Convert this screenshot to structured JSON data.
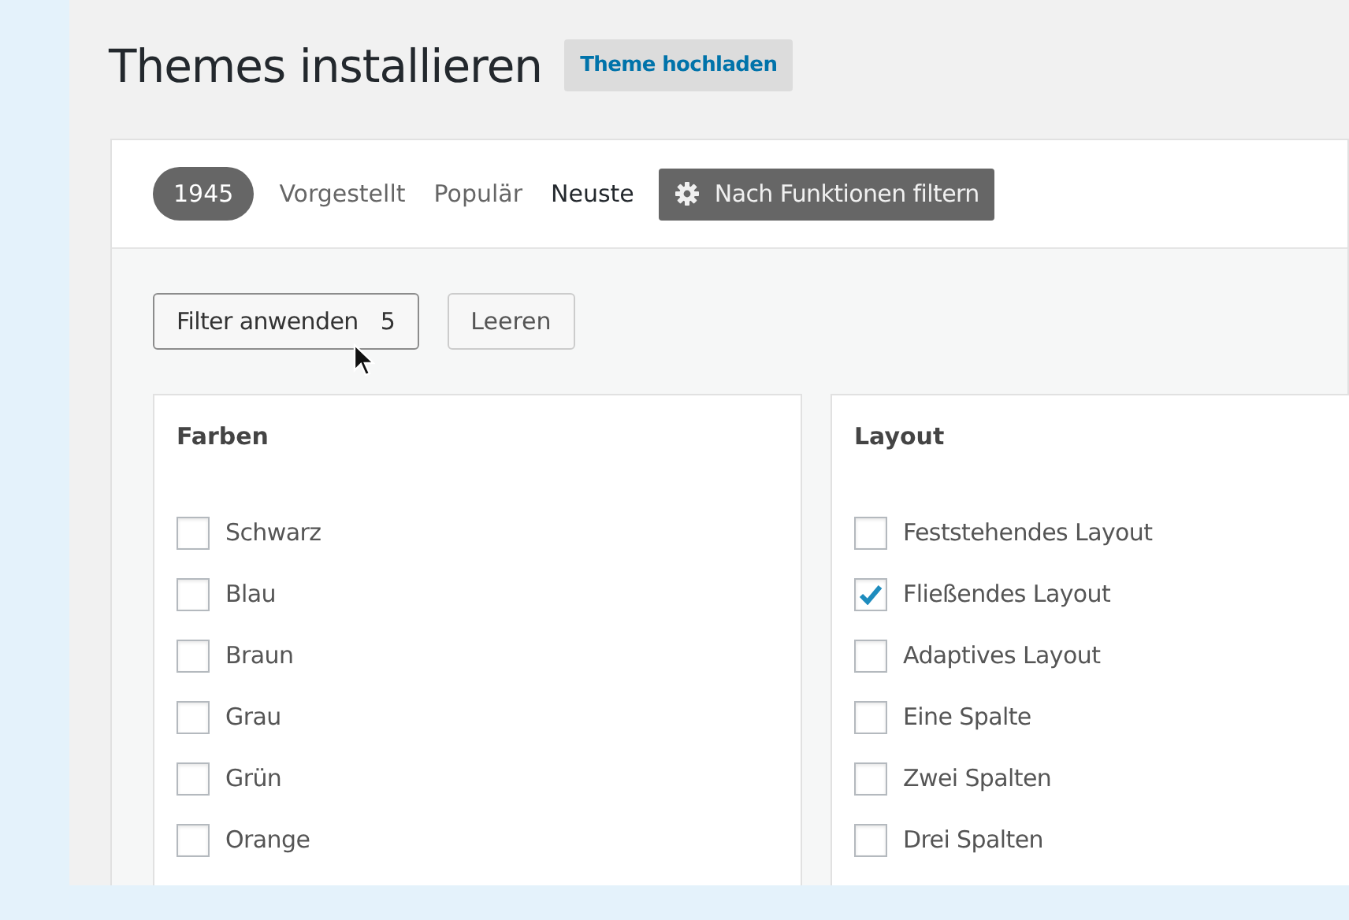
{
  "page": {
    "title": "Themes installieren",
    "upload_button": "Theme hochladen"
  },
  "filter_bar": {
    "count": "1945",
    "tabs": [
      {
        "label": "Vorgestellt",
        "selected": false
      },
      {
        "label": "Populär",
        "selected": false
      },
      {
        "label": "Neuste",
        "selected": true
      }
    ],
    "feature_filter": {
      "label": "Nach Funktionen filtern",
      "active": true
    }
  },
  "actions": {
    "apply": {
      "label": "Filter anwenden",
      "count": "5"
    },
    "clear": "Leeren"
  },
  "groups": [
    {
      "title": "Farben",
      "options": [
        {
          "label": "Schwarz",
          "checked": false
        },
        {
          "label": "Blau",
          "checked": false
        },
        {
          "label": "Braun",
          "checked": false
        },
        {
          "label": "Grau",
          "checked": false
        },
        {
          "label": "Grün",
          "checked": false
        },
        {
          "label": "Orange",
          "checked": false
        }
      ]
    },
    {
      "title": "Layout",
      "options": [
        {
          "label": "Feststehendes Layout",
          "checked": false
        },
        {
          "label": "Fließendes Layout",
          "checked": true
        },
        {
          "label": "Adaptives Layout",
          "checked": false
        },
        {
          "label": "Eine Spalte",
          "checked": false
        },
        {
          "label": "Zwei Spalten",
          "checked": false
        },
        {
          "label": "Drei Spalten",
          "checked": false
        }
      ]
    }
  ]
}
